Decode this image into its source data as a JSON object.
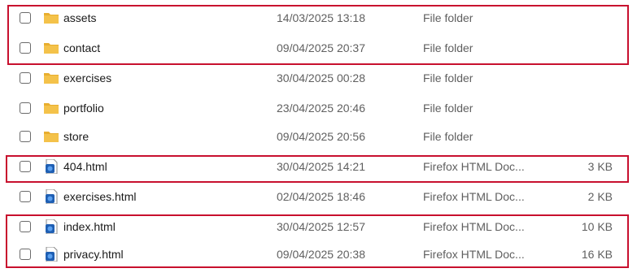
{
  "files": [
    {
      "name": "assets",
      "date": "14/03/2025 13:18",
      "type": "File folder",
      "size": "",
      "icon": "folder-icon"
    },
    {
      "name": "contact",
      "date": "09/04/2025 20:37",
      "type": "File folder",
      "size": "",
      "icon": "folder-icon"
    },
    {
      "name": "exercises",
      "date": "30/04/2025 00:28",
      "type": "File folder",
      "size": "",
      "icon": "folder-icon"
    },
    {
      "name": "portfolio",
      "date": "23/04/2025 20:46",
      "type": "File folder",
      "size": "",
      "icon": "folder-icon"
    },
    {
      "name": "store",
      "date": "09/04/2025 20:56",
      "type": "File folder",
      "size": "",
      "icon": "folder-icon"
    },
    {
      "name": "404.html",
      "date": "30/04/2025 14:21",
      "type": "Firefox HTML Doc...",
      "size": "3 KB",
      "icon": "html-file-icon"
    },
    {
      "name": "exercises.html",
      "date": "02/04/2025 18:46",
      "type": "Firefox HTML Doc...",
      "size": "2 KB",
      "icon": "html-file-icon"
    },
    {
      "name": "index.html",
      "date": "30/04/2025 12:57",
      "type": "Firefox HTML Doc...",
      "size": "10 KB",
      "icon": "html-file-icon"
    },
    {
      "name": "privacy.html",
      "date": "09/04/2025 20:38",
      "type": "Firefox HTML Doc...",
      "size": "16 KB",
      "icon": "html-file-icon"
    }
  ],
  "colors": {
    "highlight": "#c8102e",
    "folder": "#f4c24a",
    "html_file": "#1f5fb3"
  }
}
